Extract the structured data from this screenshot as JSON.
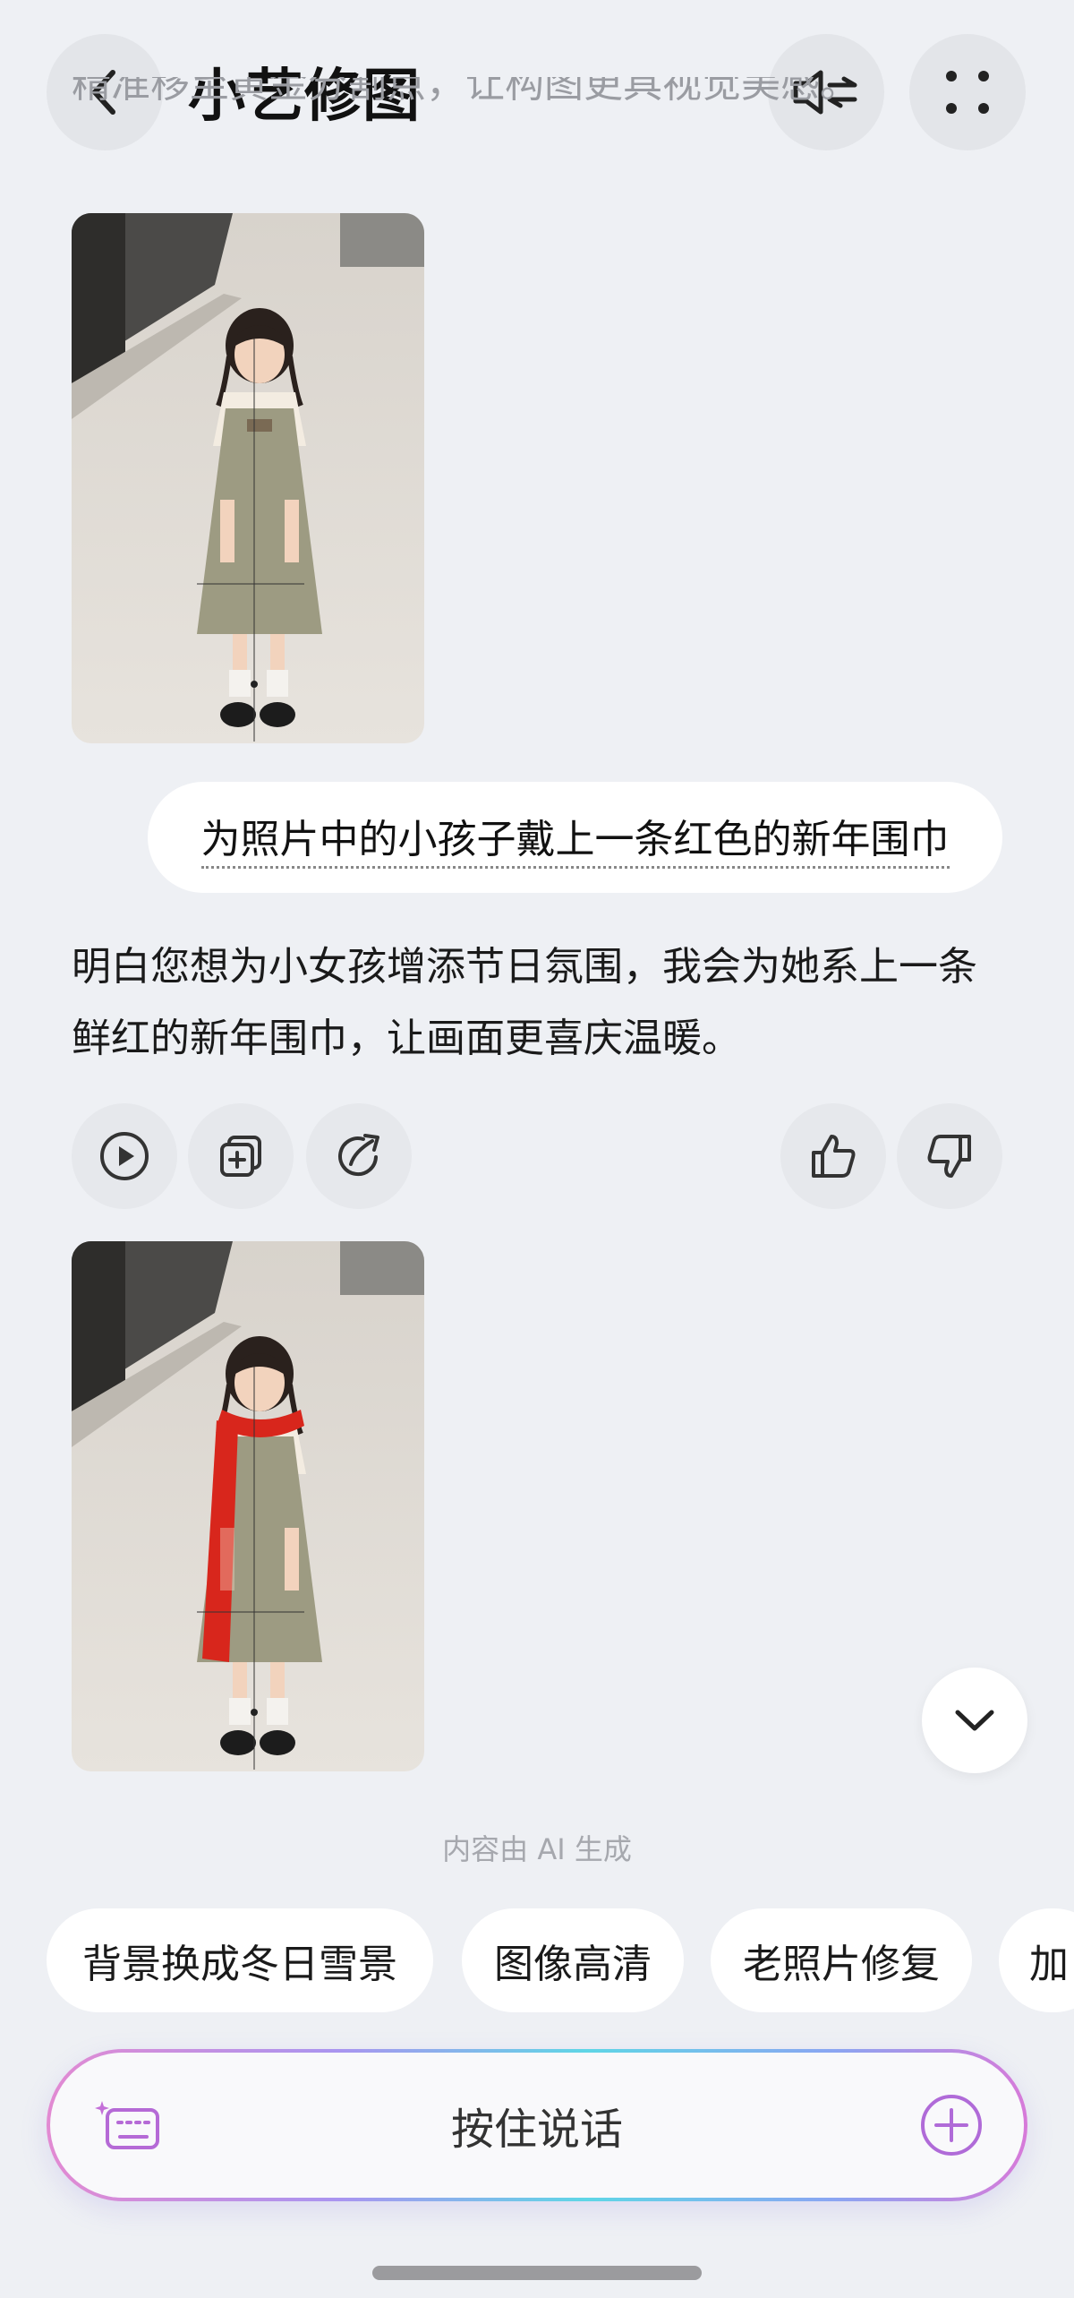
{
  "header": {
    "title": "小艺修图",
    "back_icon": "chevron-left-icon",
    "speaker_icon": "speaker-toggle-icon",
    "menu_icon": "grid-dots-icon"
  },
  "chat": {
    "cut_text": "精准移至黄金分割点，让构图更具视觉美感。",
    "user_message": "为照片中的小孩子戴上一条红色的新年围巾",
    "assistant_reply": "明白您想为小女孩增添节日氛围，我会为她系上一条鲜红的新年围巾，让画面更喜庆温暖。",
    "actions": [
      "play-icon",
      "copy-add-icon",
      "share-icon",
      "thumbs-up-icon",
      "thumbs-down-icon"
    ]
  },
  "footer": {
    "disclaimer": "内容由 AI 生成",
    "chips": [
      "背景换成冬日雪景",
      "图像高清",
      "老照片修复",
      "加"
    ],
    "input_label": "按住说话",
    "keyboard_icon": "keyboard-sparkle-icon",
    "add_icon": "plus-circle-icon"
  },
  "colors": {
    "background": "#eef0f4",
    "scarf": "#d8261c",
    "accent": "#b06bd8"
  }
}
